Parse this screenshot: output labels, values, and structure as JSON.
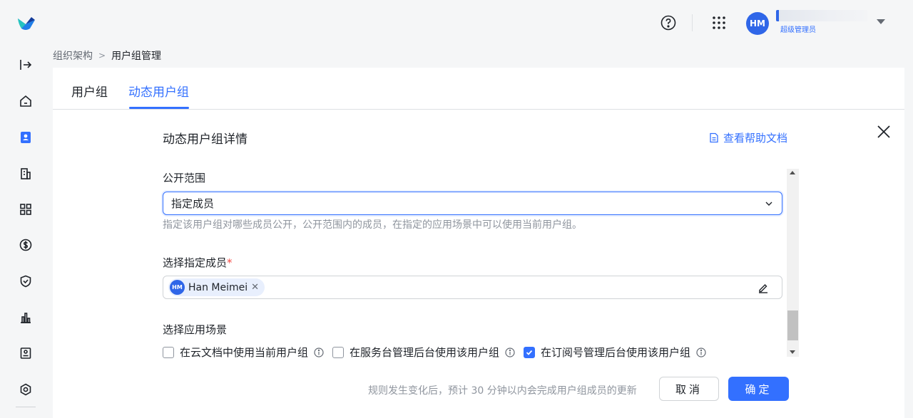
{
  "topbar": {
    "avatar_initials": "HM",
    "user_role": "超级管理员"
  },
  "breadcrumb": {
    "parent": "组织架构",
    "separator": ">",
    "current": "用户组管理"
  },
  "tabs": [
    {
      "label": "用户组",
      "active": false
    },
    {
      "label": "动态用户组",
      "active": true
    }
  ],
  "panel": {
    "title": "动态用户组详情",
    "help_link": "查看帮助文档"
  },
  "visibility": {
    "label": "公开范围",
    "selected": "指定成员",
    "hint": "指定该用户组对哪些成员公开，公开范围内的成员，在指定的应用场景中可以使用当前用户组。"
  },
  "members": {
    "label": "选择指定成员",
    "required_mark": "*",
    "chips": [
      {
        "initials": "HM",
        "name": "Han Meimei"
      }
    ]
  },
  "scenes": {
    "label": "选择应用场景",
    "options": [
      {
        "label": "在云文档中使用当前用户组",
        "checked": false
      },
      {
        "label": "在服务台管理后台使用该用户组",
        "checked": false
      },
      {
        "label": "在订阅号管理后台使用该用户组",
        "checked": true
      }
    ]
  },
  "footer": {
    "note": "规则发生变化后，预计 30 分钟以内会完成用户组成员的更新",
    "cancel_label": "取消",
    "confirm_label": "确定"
  },
  "colors": {
    "accent": "#3370ff",
    "avatar": "#2f66e8"
  }
}
